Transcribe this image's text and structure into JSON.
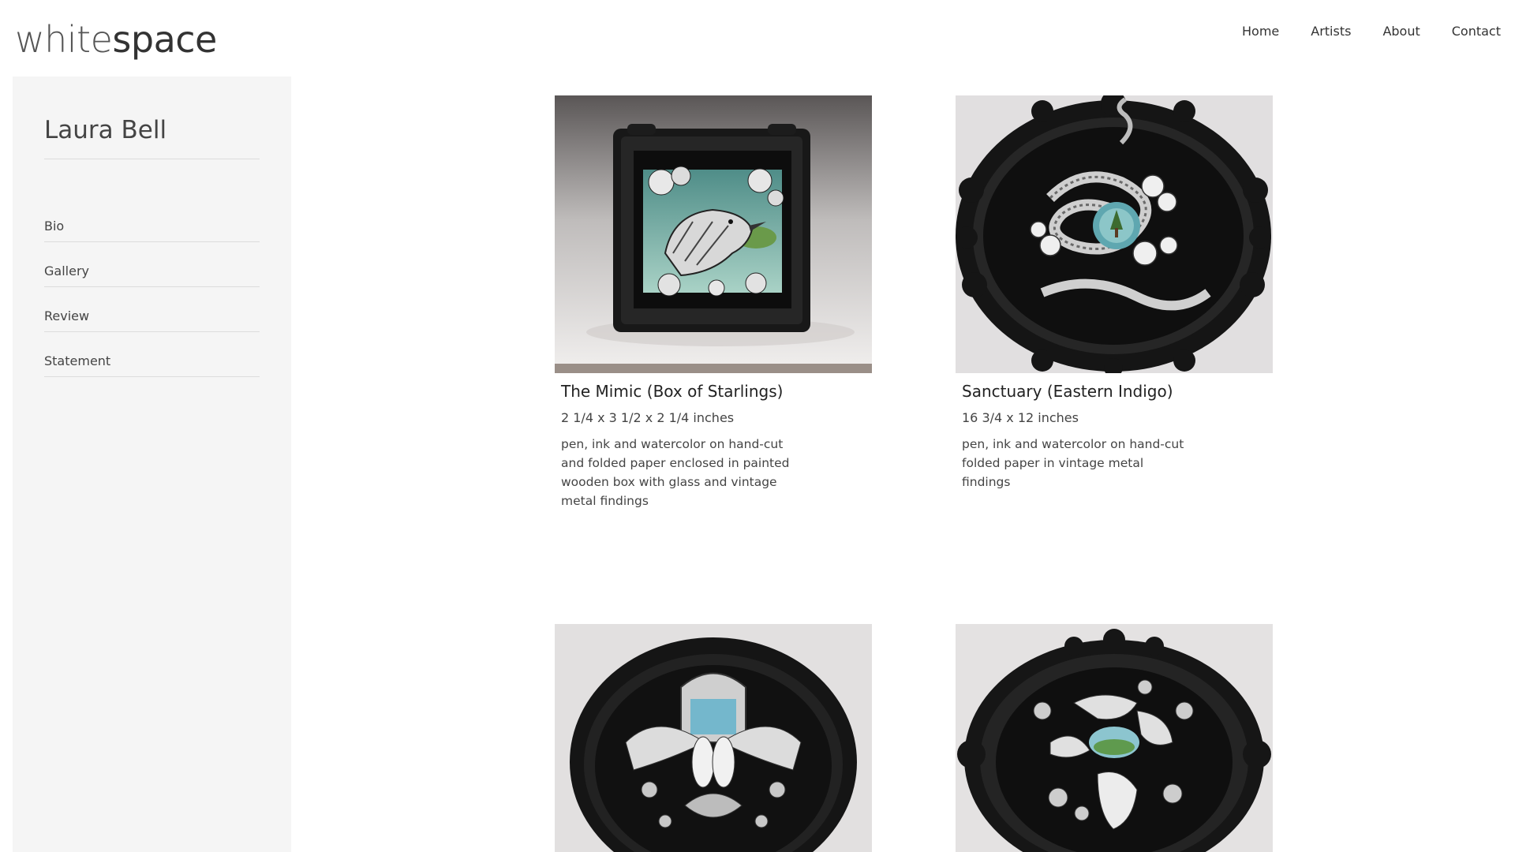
{
  "brand": {
    "logo_light": "white",
    "logo_bold": "space"
  },
  "nav": {
    "items": [
      "Home",
      "Artists",
      "About",
      "Contact"
    ]
  },
  "sidebar": {
    "artist_name": "Laura Bell",
    "items": [
      "Bio",
      "Gallery",
      "Review",
      "Statement"
    ]
  },
  "works": [
    {
      "title": "The Mimic (Box of Starlings)",
      "dimensions": "2 1/4 x 3 1/2 x 2 1/4 inches",
      "medium": "pen, ink and watercolor on hand-cut and folded paper enclosed in painted wooden box with glass and vintage metal findings"
    },
    {
      "title": "Sanctuary (Eastern Indigo)",
      "dimensions": "16 3/4 x 12 inches",
      "medium": "pen, ink and watercolor on hand-cut folded paper in vintage metal findings"
    },
    {
      "title": "",
      "dimensions": "",
      "medium": ""
    },
    {
      "title": "",
      "dimensions": "",
      "medium": ""
    }
  ],
  "colors": {
    "sidebar_bg": "#f5f5f5",
    "text": "#333333",
    "divider": "#dcdcdc"
  }
}
